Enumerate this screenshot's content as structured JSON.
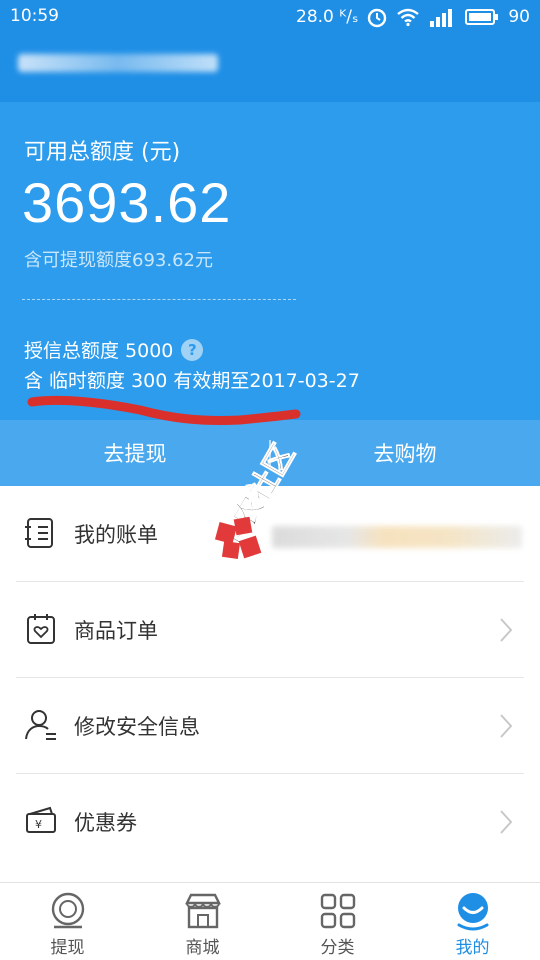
{
  "status_bar": {
    "time": "10:59",
    "net_speed": "28.0 ᴷ/ₛ",
    "battery": "90"
  },
  "credit": {
    "available_label": "可用总额度 (元)",
    "available_amount": "3693.62",
    "withdrawable_note": "含可提现额度693.62元",
    "total_line": "授信总额度 5000",
    "help_mark": "?",
    "temp_line": "含 临时额度 300 有效期至2017-03-27"
  },
  "actions": {
    "withdraw": "去提现",
    "shop": "去购物"
  },
  "watermark": "卡农社区",
  "menu": [
    {
      "label": "我的账单",
      "icon": "bill-icon"
    },
    {
      "label": "商品订单",
      "icon": "order-icon"
    },
    {
      "label": "修改安全信息",
      "icon": "user-security-icon"
    },
    {
      "label": "优惠券",
      "icon": "coupon-icon"
    }
  ],
  "nav": [
    {
      "label": "提现",
      "icon": "withdraw-icon",
      "active": false
    },
    {
      "label": "商城",
      "icon": "store-icon",
      "active": false
    },
    {
      "label": "分类",
      "icon": "category-icon",
      "active": false
    },
    {
      "label": "我的",
      "icon": "profile-icon",
      "active": true
    }
  ],
  "colors": {
    "primary": "#1f8fe6",
    "panel": "#2d9cec",
    "action_bar": "#4aa9ee",
    "scribble": "#d9302c"
  }
}
